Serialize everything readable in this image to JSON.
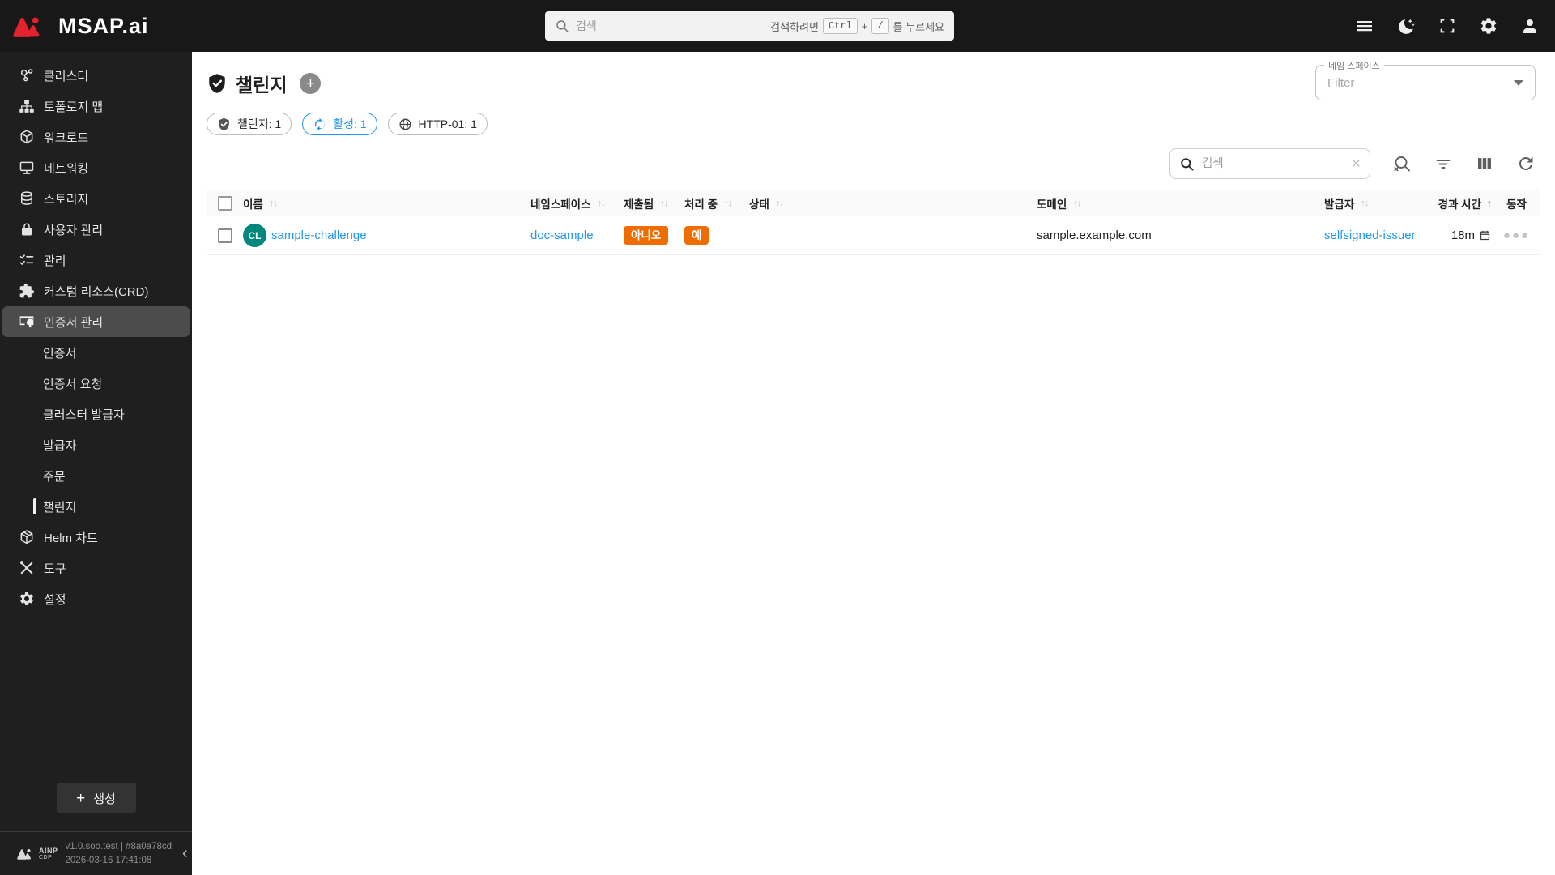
{
  "topbar": {
    "logo_text": "MSAP.ai",
    "search_placeholder": "검색",
    "hint_prefix": "검색하려면",
    "hint_key1": "Ctrl",
    "hint_plus": "+",
    "hint_key2": "/",
    "hint_suffix": "를 누르세요"
  },
  "sidebar": {
    "items": [
      {
        "label": "클러스터"
      },
      {
        "label": "토폴로지 맵"
      },
      {
        "label": "워크로드"
      },
      {
        "label": "네트워킹"
      },
      {
        "label": "스토리지"
      },
      {
        "label": "사용자 관리"
      },
      {
        "label": "관리"
      },
      {
        "label": "커스텀 리소스(CRD)"
      },
      {
        "label": "인증서 관리",
        "selected": true
      },
      {
        "label": "Helm 차트"
      },
      {
        "label": "도구"
      },
      {
        "label": "설정"
      }
    ],
    "cert_submenu": [
      {
        "label": "인증서"
      },
      {
        "label": "인증서 요청"
      },
      {
        "label": "클러스터 발급자"
      },
      {
        "label": "발급자"
      },
      {
        "label": "주문"
      },
      {
        "label": "챌린지",
        "active": true
      }
    ],
    "create_label": "생성",
    "footer": {
      "brand_line1": "AINP",
      "brand_line2": "CDP",
      "version": "v1.0.soo.test | #8a0a78cd",
      "timestamp": "2026-03-16 17:41:08"
    }
  },
  "main": {
    "title": "챌린지",
    "namespace_filter": {
      "label": "네임 스페이스",
      "placeholder": "Filter"
    },
    "chips": [
      {
        "label": "챌린지: 1",
        "icon": "shield-check-icon",
        "style": "default"
      },
      {
        "label": "활성: 1",
        "icon": "sync-icon",
        "style": "blue"
      },
      {
        "label": "HTTP-01: 1",
        "icon": "globe-icon",
        "style": "default"
      }
    ],
    "table": {
      "search_placeholder": "검색",
      "headers": [
        "이름",
        "네임스페이스",
        "제출됨",
        "처리 중",
        "상태",
        "도메인",
        "발급자",
        "경과 시간",
        "동작"
      ],
      "sorted_column": "경과 시간",
      "sort_direction": "asc",
      "rows": [
        {
          "avatar": "CL",
          "name": "sample-challenge",
          "namespace": "doc-sample",
          "presented": "아니오",
          "processing": "예",
          "state": "",
          "domain": "sample.example.com",
          "issuer": "selfsigned-issuer",
          "age": "18m"
        }
      ]
    }
  },
  "colors": {
    "accent_blue": "#2196F3",
    "badge_orange": "#EF6C00",
    "avatar_teal": "#00897B",
    "brand_red": "#E4212E"
  }
}
